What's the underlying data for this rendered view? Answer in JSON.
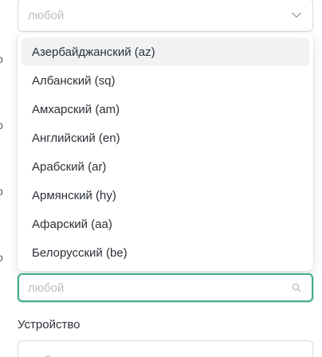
{
  "top_select": {
    "value": "любой",
    "icon": "chevron-down-icon"
  },
  "language_options": [
    "Азербайджанский (az)",
    "Албанский (sq)",
    "Амхарский (am)",
    "Английский (en)",
    "Арабский (ar)",
    "Армянский (hy)",
    "Афарский (aa)",
    "Белорусский (be)"
  ],
  "highlighted_index": 0,
  "search_select": {
    "placeholder": "любой",
    "icon": "search-icon"
  },
  "device": {
    "label": "Устройство",
    "value": "любое"
  },
  "left_edge_glyphs": [
    "р",
    "р",
    "р",
    "р",
    "р"
  ],
  "colors": {
    "focus_border": "#43ad87",
    "highlight_bg": "#f1f2f4"
  }
}
